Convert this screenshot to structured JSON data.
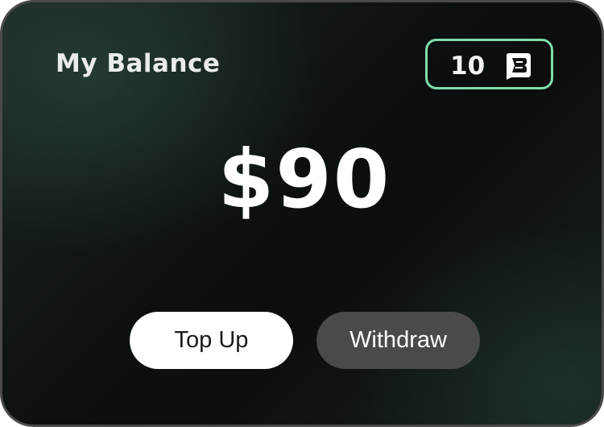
{
  "card": {
    "title": "My Balance",
    "points": {
      "value": "10",
      "icon": "brand-coin-icon",
      "border_color": "#7fdcae"
    },
    "balance": "$90",
    "actions": {
      "top_up_label": "Top Up",
      "withdraw_label": "Withdraw"
    }
  }
}
